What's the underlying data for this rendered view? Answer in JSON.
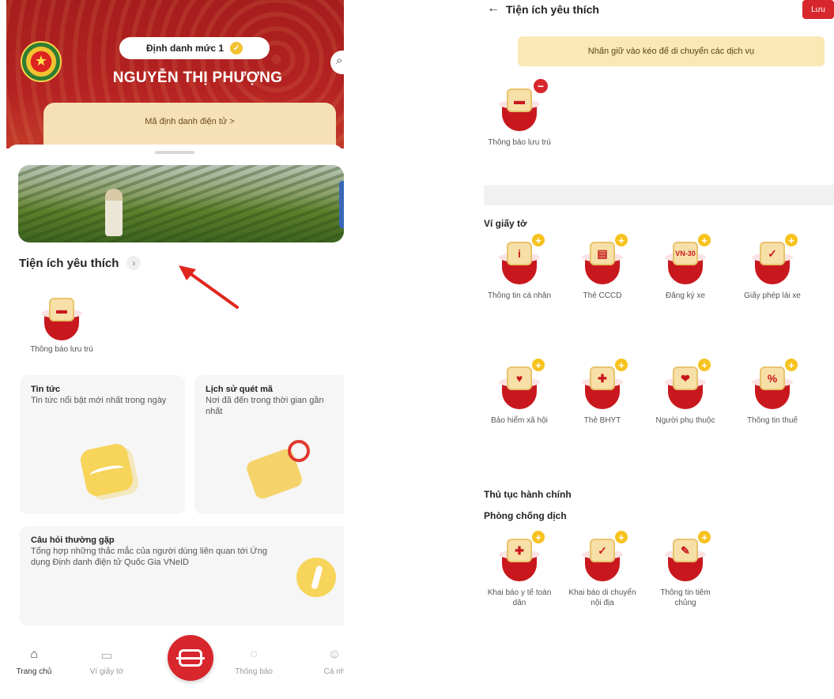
{
  "left": {
    "level_badge": "Định danh mức 1",
    "user_name": "NGUYỄN THỊ PHƯỢNG",
    "id_link": "Mã định danh điện tử  >",
    "favorites_title": "Tiện ích yêu thích",
    "favorite_item": "Thông báo lưu trú",
    "cards": {
      "news_title": "Tin tức",
      "news_desc": "Tin tức nổi bật mới nhất trong ngày",
      "scan_title": "Lịch sử quét mã",
      "scan_desc": "Nơi đã đến trong thời gian gần nhất",
      "faq_title": "Câu hỏi thường gặp",
      "faq_desc": "Tổng hợp những thắc mắc của người dùng liên quan tới Ứng dụng Định danh điện tử Quốc Gia VNeID"
    },
    "nav": {
      "home": "Trang chủ",
      "wallet": "Ví giấy tờ",
      "notice": "Thông báo",
      "profile": "Cá nh"
    }
  },
  "right": {
    "title": "Tiện ích yêu thích",
    "save": "Lưu",
    "hint": "Nhấn giữ vào kéo để di chuyển các dịch vụ",
    "selected_item": "Thông báo lưu trú",
    "wallet_section": "Ví giấy tờ",
    "wallet_items": [
      "Thông tin cá nhân",
      "Thẻ CCCD",
      "Đăng ký xe",
      "Giấy phép lái xe",
      "Bảo hiểm xã hội",
      "Thẻ BHYT",
      "Người phụ thuộc",
      "Thông tin thuế"
    ],
    "admin_section": "Thủ tục hành chính",
    "epidemic_section": "Phòng chống dịch",
    "epidemic_items": [
      "Khai báo y tế toàn dân",
      "Khai báo di chuyển nội địa",
      "Thông tin tiêm chủng"
    ],
    "plate_text": "VN-30"
  },
  "colors": {
    "brand_red": "#d7262c",
    "accent_yellow": "#f7c21e",
    "hint_bg": "#fbe8b4"
  }
}
